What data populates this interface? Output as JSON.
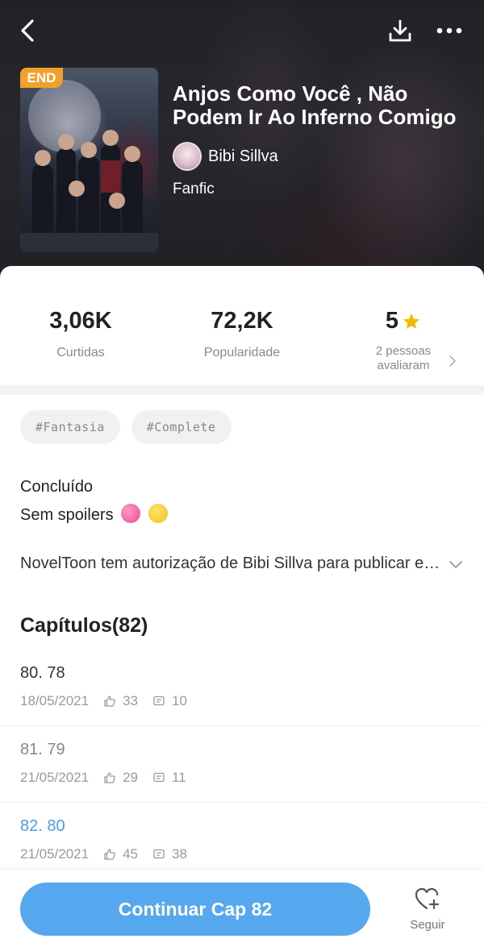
{
  "book": {
    "badge": "END",
    "title": "Anjos Como Você , Não Podem Ir Ao Inferno Comigo",
    "author": "Bibi Sillva",
    "genre": "Fanfic"
  },
  "stats": {
    "likes_value": "3,06K",
    "likes_label": "Curtidas",
    "popularity_value": "72,2K",
    "popularity_label": "Popularidade",
    "rating_value": "5",
    "rating_label": "2 pessoas avaliaram"
  },
  "tags": [
    "#Fantasia",
    "#Complete"
  ],
  "status": "Concluído",
  "description": "Sem spoilers",
  "permission": "NovelToon tem autorização de Bibi Sillva para publicar essa história",
  "chapters_header": "Capítulos(82)",
  "chapters": [
    {
      "title": "80. 78",
      "date": "18/05/2021",
      "likes": "33",
      "comments": "10"
    },
    {
      "title": "81. 79",
      "date": "21/05/2021",
      "likes": "29",
      "comments": "11"
    },
    {
      "title": "82. 80",
      "date": "21/05/2021",
      "likes": "45",
      "comments": "38"
    }
  ],
  "footer": {
    "continue_label": "Continuar Cap 82",
    "follow_label": "Seguir"
  },
  "colors": {
    "accent": "#56a8ee",
    "badge": "#f0a12a",
    "star": "#f5b800"
  }
}
